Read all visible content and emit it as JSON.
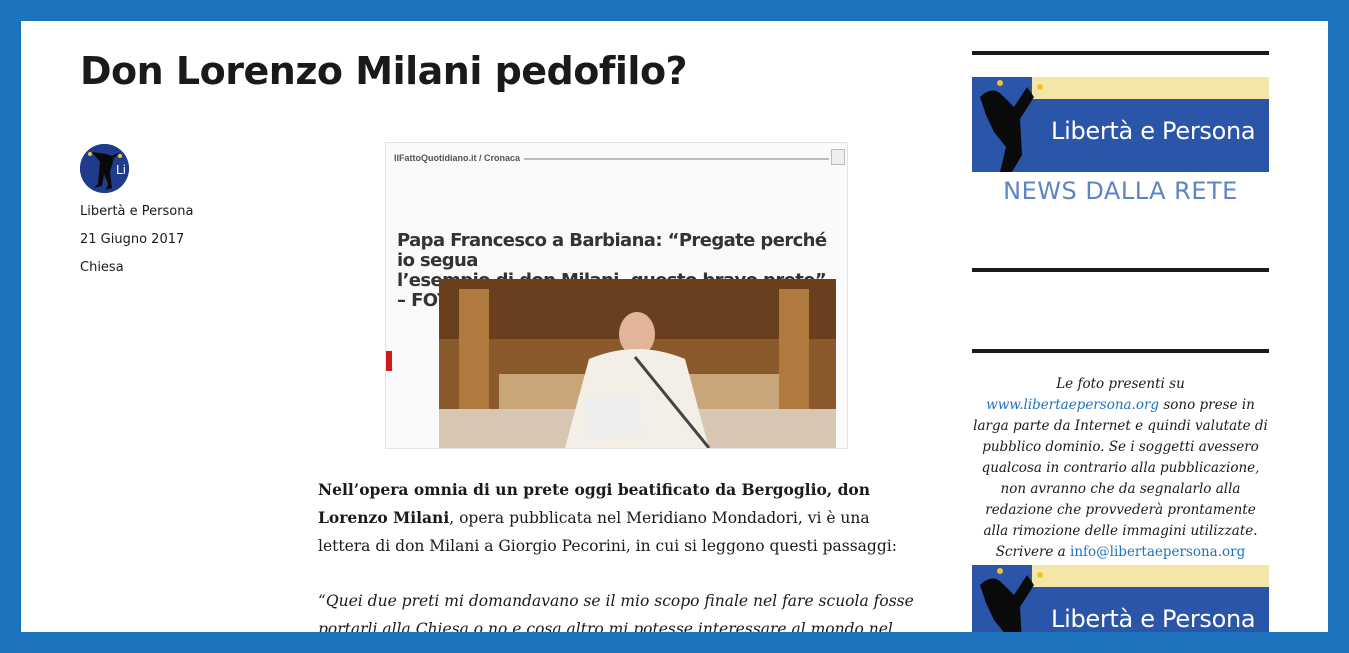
{
  "post": {
    "title": "Don Lorenzo Milani pedofilo?",
    "author": "Libertà e Persona",
    "date": "21 Giugno 2017",
    "category": "Chiesa"
  },
  "featured_image": {
    "source": "IlFattoQuotidiano.it / Cronaca",
    "headline_line1": "Papa Francesco a Barbiana: “Pregate perché io segua",
    "headline_line2": "l’esempio di don Milani, questo bravo prete” – FOTO"
  },
  "content": {
    "p1_bold": "Nell’opera omnia di un prete oggi beatificato da Bergoglio,  don Lorenzo Milani",
    "p1_rest": ", opera pubblicata nel Meridiano Mondadori, vi è una lettera di don Milani a Giorgio Pecorini, in cui si leggono questi passaggi:",
    "p2": "“Quei due preti mi domandavano se il mio scopo finale nel fare scuola fosse portarli alla Chiesa o no e cosa altro mi potesse interessare al mondo nel fare"
  },
  "sidebar": {
    "banner_title": "Libertà e Persona",
    "news_label": "NEWS DALLA RETE",
    "notice": {
      "intro": "Le foto presenti su",
      "site_link": "www.libertaepersona.org",
      "body": "sono prese in larga parte da Internet e quindi valutate di pubblico dominio. Se i soggetti avessero qualcosa in contrario alla pubblicazione, non avranno che da segnalarlo alla redazione che provvederà prontamente alla rimozione delle immagini utilizzate.",
      "write": "Scrivere a",
      "email": "info@libertaepersona.org"
    }
  },
  "colors": {
    "frame": "#1e73be",
    "link": "#1e73be",
    "news": "#5d84c4"
  }
}
